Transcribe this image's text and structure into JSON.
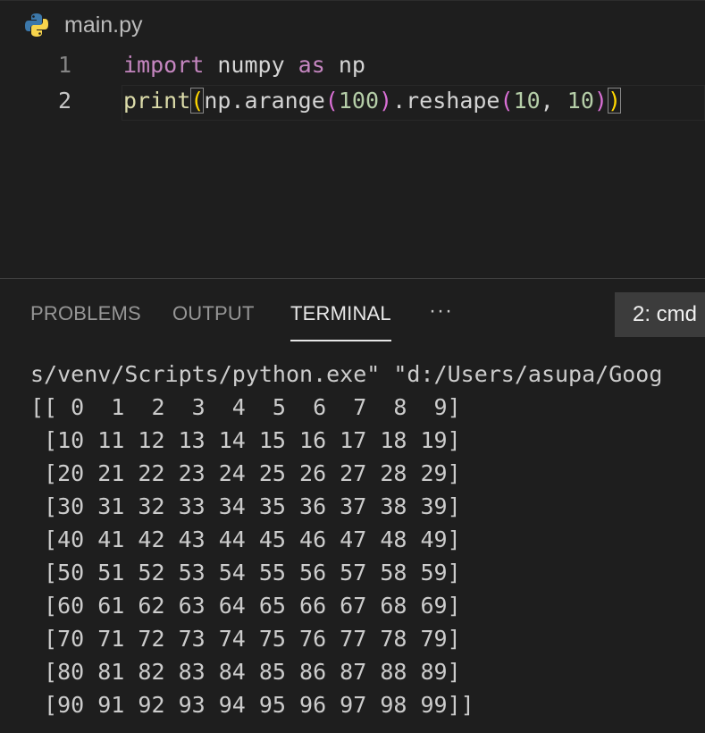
{
  "editor": {
    "filename": "main.py",
    "file_icon": "python-icon",
    "line_numbers": [
      "1",
      "2"
    ],
    "line1": {
      "kw_import": "import",
      "mod": " numpy ",
      "kw_as": "as",
      "alias": " np"
    },
    "line2": {
      "fn_print": "print",
      "open1": "(",
      "call": "np.arange",
      "open2": "(",
      "n100": "100",
      "close2": ")",
      "method": ".reshape",
      "open3": "(",
      "n10a": "10",
      "comma": ", ",
      "n10b": "10",
      "close3": ")",
      "close1": ")"
    }
  },
  "panel": {
    "tabs": [
      "PROBLEMS",
      "OUTPUT",
      "TERMINAL"
    ],
    "active_tab": "TERMINAL",
    "more_label": "···",
    "terminal_selector": "2: cmd",
    "terminal_lines": [
      "s/venv/Scripts/python.exe\" \"d:/Users/asupa/Goog",
      "[[ 0  1  2  3  4  5  6  7  8  9]",
      " [10 11 12 13 14 15 16 17 18 19]",
      " [20 21 22 23 24 25 26 27 28 29]",
      " [30 31 32 33 34 35 36 37 38 39]",
      " [40 41 42 43 44 45 46 47 48 49]",
      " [50 51 52 53 54 55 56 57 58 59]",
      " [60 61 62 63 64 65 66 67 68 69]",
      " [70 71 72 73 74 75 76 77 78 79]",
      " [80 81 82 83 84 85 86 87 88 89]",
      " [90 91 92 93 94 95 96 97 98 99]]"
    ]
  }
}
